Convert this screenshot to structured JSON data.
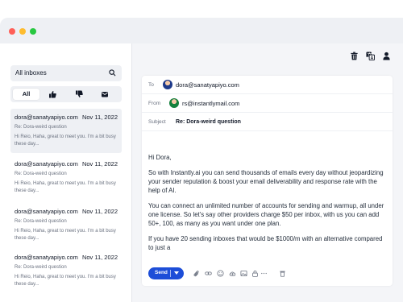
{
  "sidebar": {
    "search_label": "All inboxes",
    "filter_all_label": "All",
    "filters": [
      "thumbs-up-icon",
      "thumbs-down-icon",
      "inbox-icon"
    ],
    "mails": [
      {
        "from": "dora@sanatyapiyo.com",
        "date": "Nov 11, 2022",
        "subject": "Re: Dora-weird question",
        "preview": "Hi Reio, Haha, great to meet you. I'm a bit busy these day..."
      },
      {
        "from": "dora@sanatyapiyo.com",
        "date": "Nov 11, 2022",
        "subject": "Re: Dora-weird question",
        "preview": "Hi Reio, Haha, great to meet you. I'm a bit busy these day..."
      },
      {
        "from": "dora@sanatyapiyo.com",
        "date": "Nov 11, 2022",
        "subject": "Re: Dora-weird question",
        "preview": "Hi Reio, Haha, great to meet you. I'm a bit busy these day..."
      },
      {
        "from": "dora@sanatyapiyo.com",
        "date": "Nov 11, 2022",
        "subject": "Re: Dora-weird question",
        "preview": "Hi Reio, Haha, great to meet you. I'm a bit busy these day..."
      }
    ]
  },
  "toolbar": {
    "icons": [
      "trash-icon",
      "translate-icon",
      "user-icon"
    ]
  },
  "compose": {
    "to_label": "To",
    "to_value": "dora@sanatyapiyo.com",
    "from_label": "From",
    "from_value": "rs@instantlymail.com",
    "subject_label": "Subject",
    "subject_value": "Re: Dora-weird question",
    "body": {
      "greeting": "Hi Dora,",
      "p1": "So with Instantly.ai you can send thousands of emails every day without jeopardizing your sender reputation & boost your email deliverability and response rate with the help of AI.",
      "p2": "You can connect an unlimited number of accounts for sending and warmup, all under one license. So let's say other providers charge $50 per inbox, with us you can add 50+, 100, as many as you want under one plan.",
      "p3": "If you have 20 sending inboxes that would be $1000/m with an alternative compared to just a"
    },
    "send_label": "Send"
  },
  "colors": {
    "accent": "#1d4ed8",
    "sidebar_active": "#eef0f4",
    "background": "#f4f5f8"
  }
}
